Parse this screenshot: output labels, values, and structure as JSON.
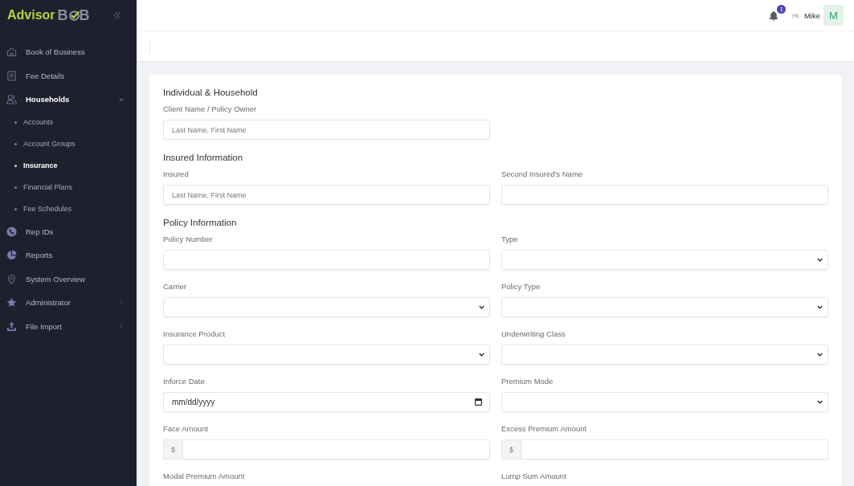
{
  "sidebar": {
    "logo": {
      "name": "Advisor",
      "mark_start": "B",
      "mark_end": "B"
    },
    "items": [
      {
        "label": "Book of Business",
        "kind": "link",
        "selected": false
      },
      {
        "label": "Fee Details",
        "kind": "link",
        "selected": false
      },
      {
        "label": "Households",
        "kind": "group",
        "selected": true,
        "expanded": true,
        "children": [
          {
            "label": "Accounts",
            "selected": false
          },
          {
            "label": "Account Groups",
            "selected": false
          },
          {
            "label": "Insurance",
            "selected": true
          },
          {
            "label": "Financial Plans",
            "selected": false
          },
          {
            "label": "Fee Schedules",
            "selected": false
          }
        ]
      },
      {
        "label": "Rep IDs",
        "kind": "link",
        "selected": false
      },
      {
        "label": "Reports",
        "kind": "link",
        "selected": false
      },
      {
        "label": "System Overview",
        "kind": "link",
        "selected": false
      },
      {
        "label": "Administrator",
        "kind": "group",
        "selected": false,
        "expanded": false
      },
      {
        "label": "File Import",
        "kind": "group",
        "selected": false,
        "expanded": false
      }
    ]
  },
  "top_bar": {
    "notification_count": "1",
    "greeting": "Hi,",
    "user_name": "Mike",
    "avatar_initial": "M"
  },
  "form": {
    "sections": [
      {
        "title": "Individual & Household",
        "fields": [
          {
            "label": "Client Name / Policy Owner",
            "kind": "text",
            "placeholder": "Last Name, First Name"
          }
        ]
      },
      {
        "title": "Insured Information",
        "fields": [
          {
            "label": "Insured",
            "kind": "text",
            "placeholder": "Last Name, First Name"
          },
          {
            "label": "Second Insured's Name",
            "kind": "text"
          }
        ]
      },
      {
        "title": "Policy Information",
        "fields": [
          {
            "label": "Policy Number",
            "kind": "text"
          },
          {
            "label": "Type",
            "kind": "select"
          },
          {
            "label": "Carrier",
            "kind": "select"
          },
          {
            "label": "Policy Type",
            "kind": "select"
          },
          {
            "label": "Insurance Product",
            "kind": "select"
          },
          {
            "label": "Underwriting Class",
            "kind": "select"
          },
          {
            "label": "Inforce Date",
            "kind": "date",
            "placeholder": "mm/dd/yyyy"
          },
          {
            "label": "Premium Mode",
            "kind": "select"
          },
          {
            "label": "Face Amount",
            "kind": "currency",
            "prefix": "$"
          },
          {
            "label": "Excess Premium Amount",
            "kind": "currency",
            "prefix": "$"
          },
          {
            "label": "Modal Premium Amount"
          },
          {
            "label": "Lump Sum Amount"
          }
        ]
      }
    ]
  }
}
